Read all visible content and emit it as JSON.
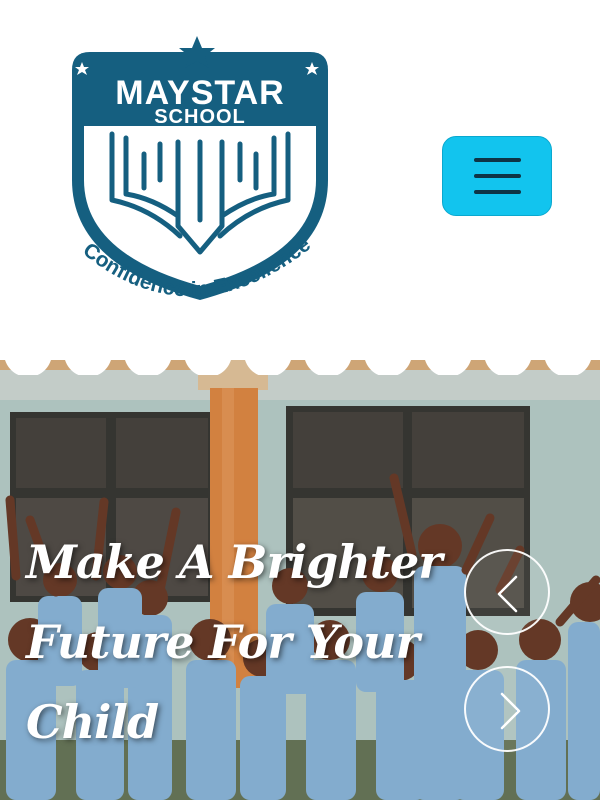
{
  "header": {
    "logo": {
      "name": "MAYSTAR",
      "subname": "SCHOOL",
      "motto": "Confidence in Excellence",
      "color": "#155f80"
    },
    "menu_button": {
      "icon": "hamburger-icon",
      "color": "#12c4ee"
    }
  },
  "hero": {
    "title_lines": [
      "Make A Brighter",
      "Future For Your",
      "Child"
    ],
    "prev_icon": "chevron-left-icon",
    "next_icon": "chevron-right-icon"
  }
}
